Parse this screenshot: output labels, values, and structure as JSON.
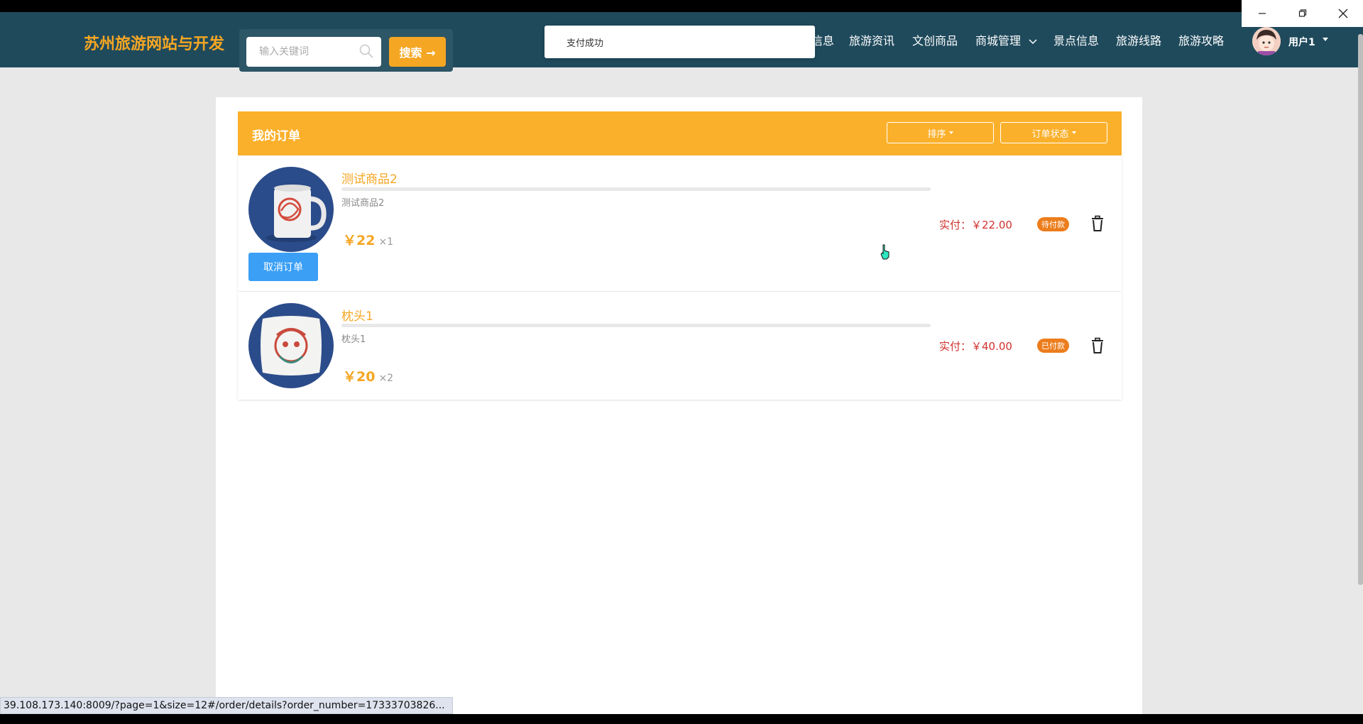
{
  "brand": {
    "title": "苏州旅游网站与开发"
  },
  "search": {
    "placeholder": "输入关键词",
    "button_label": "搜索 →"
  },
  "toast": {
    "message": "支付成功"
  },
  "nav": {
    "items": [
      {
        "label": "信息"
      },
      {
        "label": "旅游资讯"
      },
      {
        "label": "文创商品"
      },
      {
        "label": "商城管理"
      },
      {
        "label": "景点信息"
      },
      {
        "label": "旅游线路"
      },
      {
        "label": "旅游攻略"
      }
    ]
  },
  "user": {
    "name": "用户1"
  },
  "orders": {
    "title": "我的订单",
    "sort_label": "排序",
    "status_label": "订单状态",
    "items": [
      {
        "name": "测试商品2",
        "desc": "测试商品2",
        "price": "￥22",
        "qty": "×1",
        "paid_label": "实付：￥22.00",
        "status": "待付款",
        "cancel_label": "取消订单"
      },
      {
        "name": "枕头1",
        "desc": "枕头1",
        "price": "￥20",
        "qty": "×2",
        "paid_label": "实付：￥40.00",
        "status": "已付款"
      }
    ]
  },
  "statusbar": {
    "url": "39.108.173.140:8009/?page=1&size=12#/order/details?order_number=17333703826..."
  },
  "colors": {
    "navbar": "#1f4a5c",
    "accent": "#f5a623",
    "header": "#fbb02b",
    "cancel": "#3a9ff5",
    "badge": "#ec7d1c",
    "price_paid": "#d0312d"
  }
}
